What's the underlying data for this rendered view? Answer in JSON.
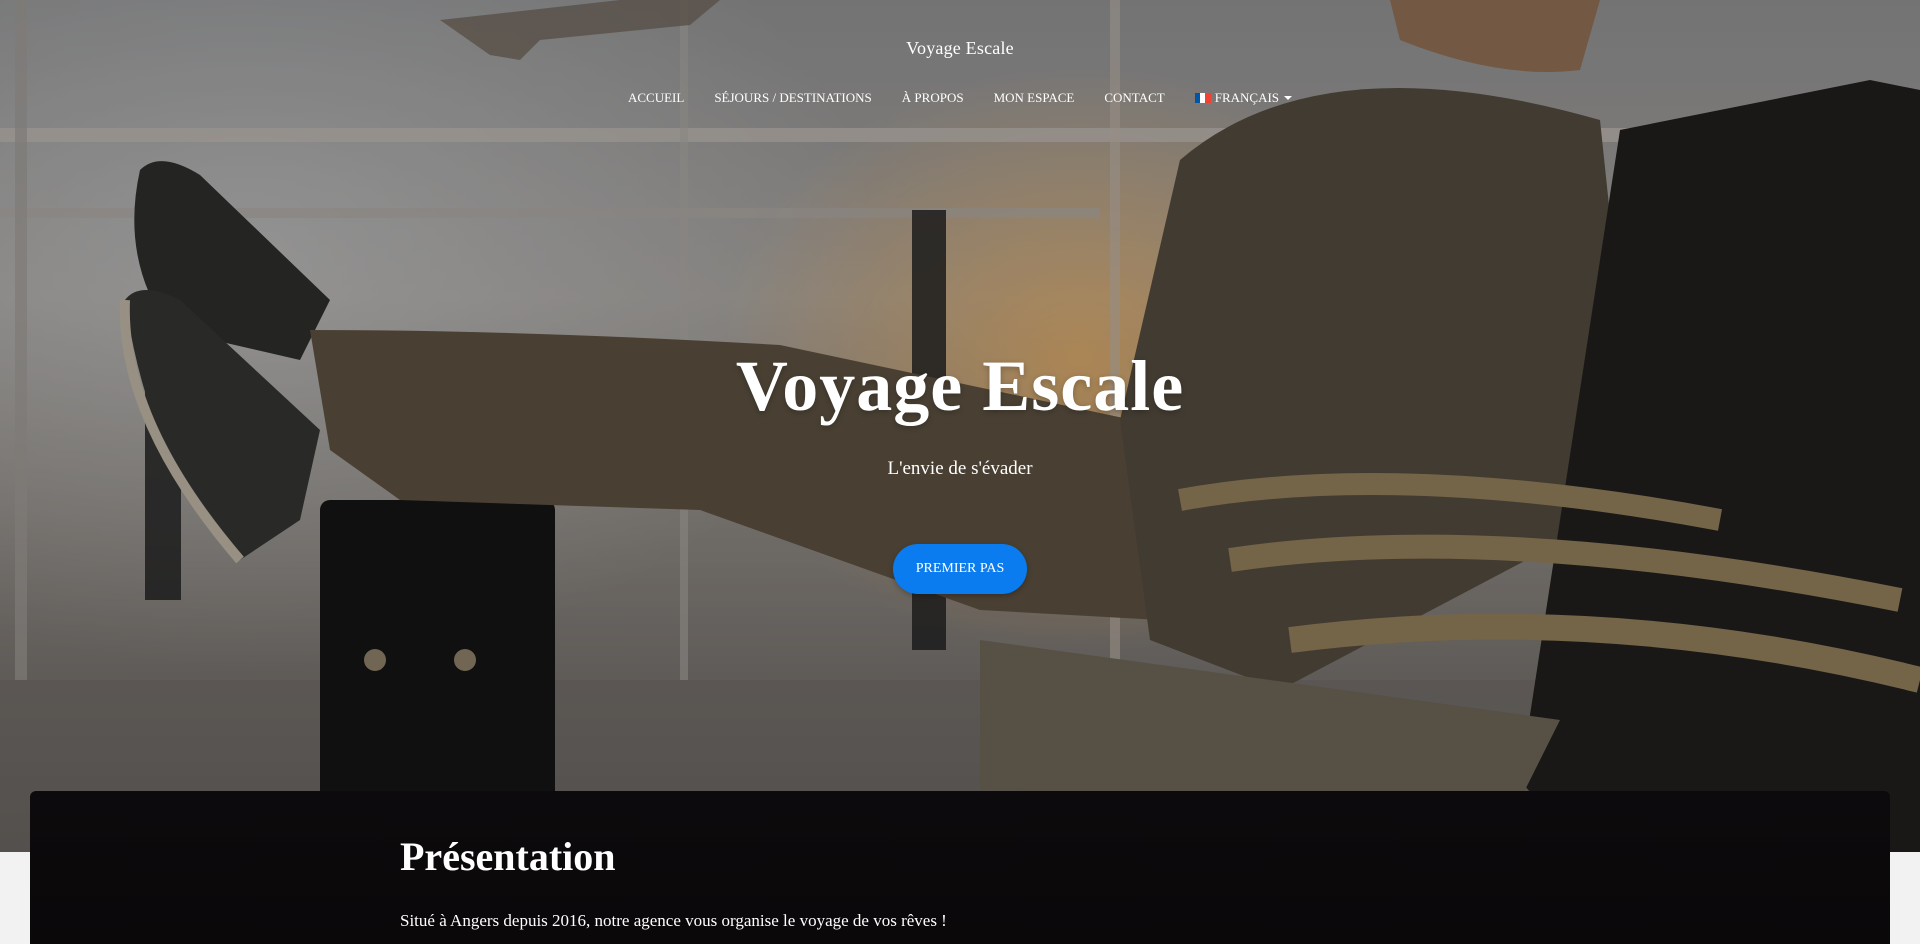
{
  "site": {
    "brand": "Voyage Escale"
  },
  "nav": {
    "items": [
      "Accueil",
      "Séjours / Destinations",
      "À propos",
      "Mon espace",
      "Contact"
    ],
    "language": "Français",
    "language_flag_colors": [
      "#0055a4",
      "#ffffff",
      "#ef4135"
    ]
  },
  "hero": {
    "title": "Voyage Escale",
    "subtitle": "L'envie de s'évader",
    "cta_label": "Premier pas",
    "cta_color": "#0a7cf0"
  },
  "presentation": {
    "heading": "Présentation",
    "text": "Situé à Angers depuis 2016, notre agence vous organise le voyage de vos rêves !"
  }
}
